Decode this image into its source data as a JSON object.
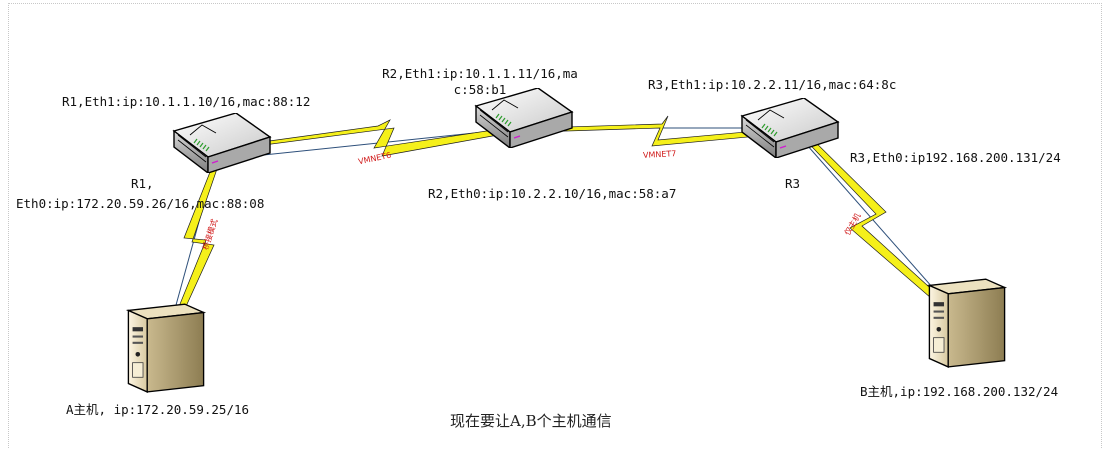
{
  "nodes": {
    "r1_eth1": "R1,Eth1:ip:10.1.1.10/16,mac:88:12",
    "r1_name": "R1,",
    "r1_eth0": "Eth0:ip:172.20.59.26/16,mac:88:08",
    "r2_eth1": "R2,Eth1:ip:10.1.1.11/16,mac:58:b1",
    "r2_eth0": "R2,Eth0:ip:10.2.2.10/16,mac:58:a7",
    "r3_eth1": "R3,Eth1:ip:10.2.2.11/16,mac:64:8c",
    "r3_name": "R3",
    "r3_eth0": "R3,Eth0:ip192.168.200.131/24",
    "host_a": "A主机, ip:172.20.59.25/16",
    "host_b": "B主机,ip:192.168.200.132/24"
  },
  "links": {
    "vmnet6": "VMNET6",
    "vmnet7": "VMNET7",
    "bridge": "桥接模式",
    "host_only": "仅主机"
  },
  "caption": "现在要让A,B个主机通信",
  "colors": {
    "link_label": "#d01818",
    "bolt": "#f5f01a",
    "line": "#2d4f7a"
  }
}
